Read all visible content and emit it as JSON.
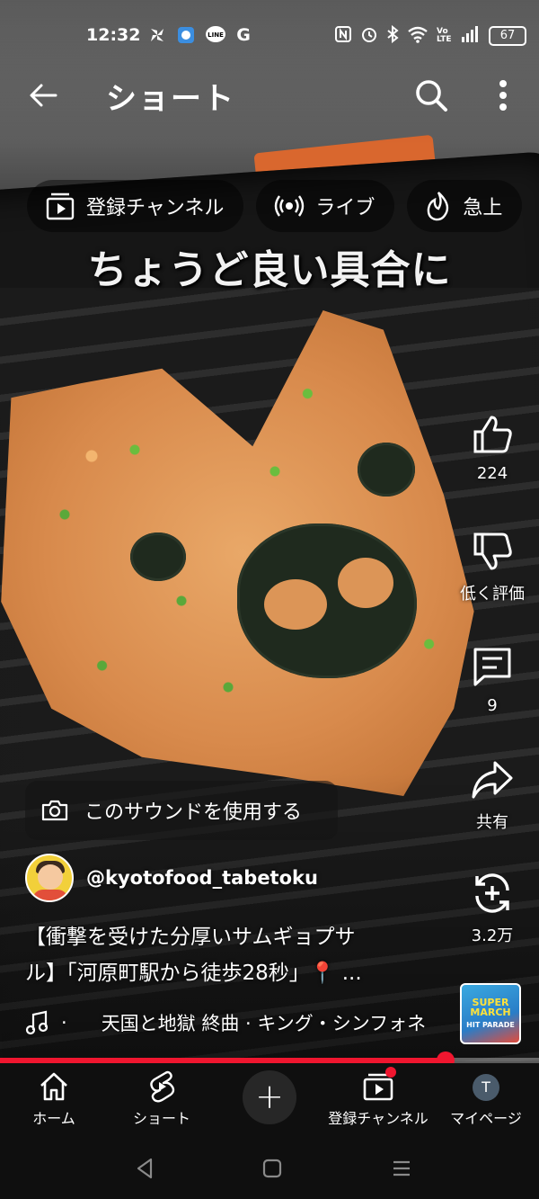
{
  "status_bar": {
    "time": "12:32",
    "left_icons": [
      "pinwheel-icon",
      "game-app-icon",
      "line-app-icon",
      "google-icon"
    ],
    "line_label": "LINE",
    "google_label": "G",
    "right_icons": [
      "nfc-icon",
      "alarm-icon",
      "bluetooth-icon",
      "wifi-icon",
      "volte-icon",
      "signal-icon"
    ],
    "volte_label": "Vo LTE",
    "battery": "67"
  },
  "app_bar": {
    "title": "ショート",
    "icons": [
      "back-arrow-icon",
      "search-icon",
      "more-vert-icon"
    ]
  },
  "chips": [
    {
      "label": "登録チャンネル",
      "icon": "subscriptions-icon"
    },
    {
      "label": "ライブ",
      "icon": "live-icon"
    },
    {
      "label": "急上",
      "icon": "trending-icon"
    }
  ],
  "video": {
    "overlay_caption": "ちょうど良い具合に"
  },
  "actions": {
    "like": {
      "label": "224",
      "icon": "thumbs-up-icon"
    },
    "dislike": {
      "label": "低く評価",
      "icon": "thumbs-down-icon"
    },
    "comment": {
      "label": "9",
      "icon": "comment-icon"
    },
    "share": {
      "label": "共有",
      "icon": "share-icon"
    },
    "remix": {
      "label": "3.2万",
      "icon": "remix-icon"
    }
  },
  "sound_button": {
    "label": "このサウンドを使用する",
    "icon": "camera-icon"
  },
  "channel": {
    "handle": "@kyotofood_tabetoku"
  },
  "description": {
    "line1": "【衝撃を受けた分厚いサムギョプサ",
    "line2": "ル】「河原町駅から徒歩28秒」📍 ..."
  },
  "music": {
    "separator": "·",
    "track": "天国と地獄 終曲 · キング・シンフォネ",
    "album_art_text": {
      "title": "SUPER MARCH",
      "subtitle": "HIT PARADE"
    }
  },
  "progress": {
    "fraction": 0.827
  },
  "bottom_nav": {
    "home": "ホーム",
    "shorts": "ショート",
    "create_symbol": "+",
    "subscriptions": "登録チャンネル",
    "my_page": "マイページ",
    "avatar_letter": "T"
  },
  "colors": {
    "accent_red": "#f0162f",
    "nav_background": "#0f0f0f"
  }
}
